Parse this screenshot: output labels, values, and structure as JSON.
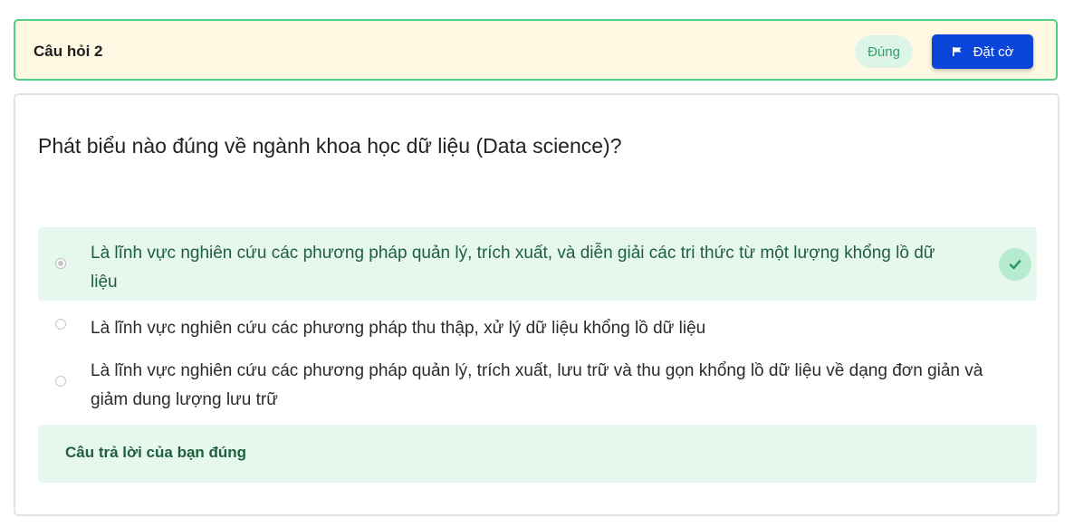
{
  "header": {
    "title": "Câu hỏi 2",
    "status": "Đúng",
    "flag_label": "Đặt cờ"
  },
  "question": {
    "text": "Phát biểu nào đúng về ngành khoa học dữ liệu (Data science)?",
    "options": [
      {
        "line1": "Là lĩnh vực nghiên cứu các phương pháp quản lý, trích xuất, và diễn giải các tri thức từ một lượng khổng lồ dữ",
        "line2": "liệu",
        "selected": true,
        "correct": true
      },
      {
        "line1": "Là lĩnh vực nghiên cứu các phương pháp thu thập, xử lý dữ liệu khổng lồ dữ liệu",
        "selected": false,
        "correct": false
      },
      {
        "line1": "Là lĩnh vực nghiên cứu các phương pháp quản lý, trích xuất, lưu trữ và thu gọn khổng lồ dữ liệu về dạng đơn giản và",
        "line2": "giảm dung lượng lưu trữ",
        "selected": false,
        "correct": false
      }
    ]
  },
  "feedback": {
    "text": "Câu trả lời của bạn đúng"
  },
  "colors": {
    "accent": "#0b44d8",
    "success": "#4fcf8c",
    "header_bg": "#fff8e3",
    "correct_bg": "#e6f7ee"
  },
  "icons": {
    "flag": "flag-icon",
    "check": "check-icon"
  }
}
